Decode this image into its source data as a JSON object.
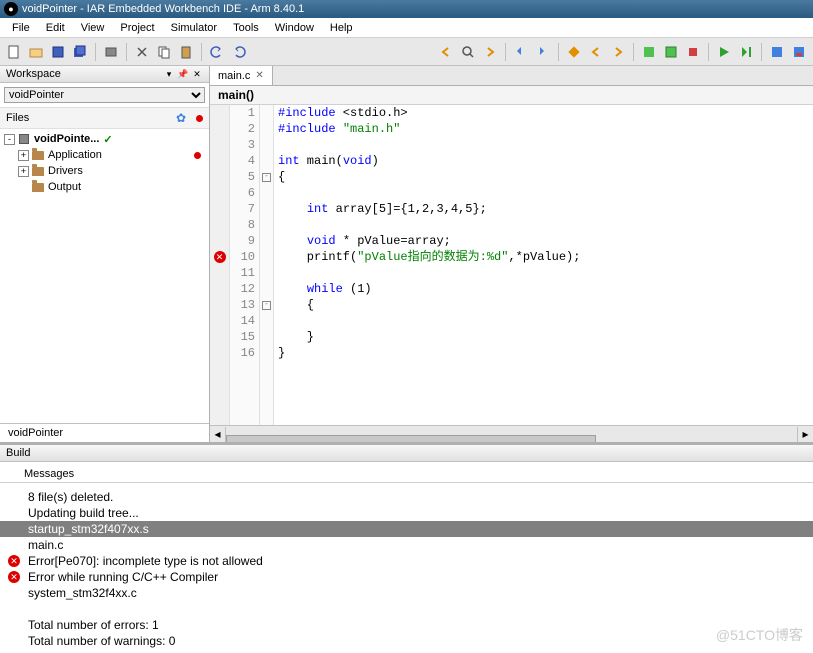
{
  "window_title": "voidPointer - IAR Embedded Workbench IDE - Arm 8.40.1",
  "menu": [
    "File",
    "Edit",
    "View",
    "Project",
    "Simulator",
    "Tools",
    "Window",
    "Help"
  ],
  "workspace": {
    "panel_title": "Workspace",
    "project_selected": "voidPointer",
    "files_label": "Files",
    "tree": [
      {
        "indent": 0,
        "exp": "-",
        "icon": "cube",
        "label": "voidPointe...",
        "bold": true,
        "check": true,
        "red": false
      },
      {
        "indent": 1,
        "exp": "+",
        "icon": "folder",
        "label": "Application",
        "red": true
      },
      {
        "indent": 1,
        "exp": "+",
        "icon": "folder",
        "label": "Drivers",
        "red": false
      },
      {
        "indent": 1,
        "exp": "",
        "icon": "folder",
        "label": "Output",
        "red": false
      }
    ],
    "bottom_tab": "voidPointer"
  },
  "editor": {
    "tab_label": "main.c",
    "func_label": "main()",
    "lines": [
      {
        "n": 1,
        "html": "<span class='kw-pp'>#include</span> &lt;stdio.h&gt;"
      },
      {
        "n": 2,
        "html": "<span class='kw-pp'>#include</span> <span class='str-green'>\"main.h\"</span>"
      },
      {
        "n": 3,
        "html": ""
      },
      {
        "n": 4,
        "html": "<span class='kw-blue'>int</span> main(<span class='kw-blue'>void</span>)"
      },
      {
        "n": 5,
        "html": "{",
        "fold": "-"
      },
      {
        "n": 6,
        "html": ""
      },
      {
        "n": 7,
        "html": "    <span class='kw-blue'>int</span> array[5]={1,2,3,4,5};"
      },
      {
        "n": 8,
        "html": ""
      },
      {
        "n": 9,
        "html": "    <span class='kw-blue'>void</span> * pValue=array;"
      },
      {
        "n": 10,
        "html": "    printf(<span class='str-green'>\"pValue指向的数据为:%d\"</span>,*pValue);",
        "err": true
      },
      {
        "n": 11,
        "html": ""
      },
      {
        "n": 12,
        "html": "    <span class='kw-blue'>while</span> (1)"
      },
      {
        "n": 13,
        "html": "    {",
        "fold": "-"
      },
      {
        "n": 14,
        "html": ""
      },
      {
        "n": 15,
        "html": "    }"
      },
      {
        "n": 16,
        "html": "}"
      }
    ]
  },
  "build": {
    "panel_title": "Build",
    "messages_label": "Messages",
    "rows": [
      {
        "text": "8  file(s) deleted."
      },
      {
        "text": "Updating build tree..."
      },
      {
        "text": "startup_stm32f407xx.s",
        "hl": true
      },
      {
        "text": "main.c"
      },
      {
        "text": "Error[Pe070]: incomplete type is not allowed",
        "err": true
      },
      {
        "text": "Error while running C/C++ Compiler",
        "err": true
      },
      {
        "text": "system_stm32f4xx.c"
      },
      {
        "text": ""
      },
      {
        "text": "Total number of errors: 1"
      },
      {
        "text": "Total number of warnings: 0"
      }
    ]
  },
  "watermark": "@51CTO博客"
}
